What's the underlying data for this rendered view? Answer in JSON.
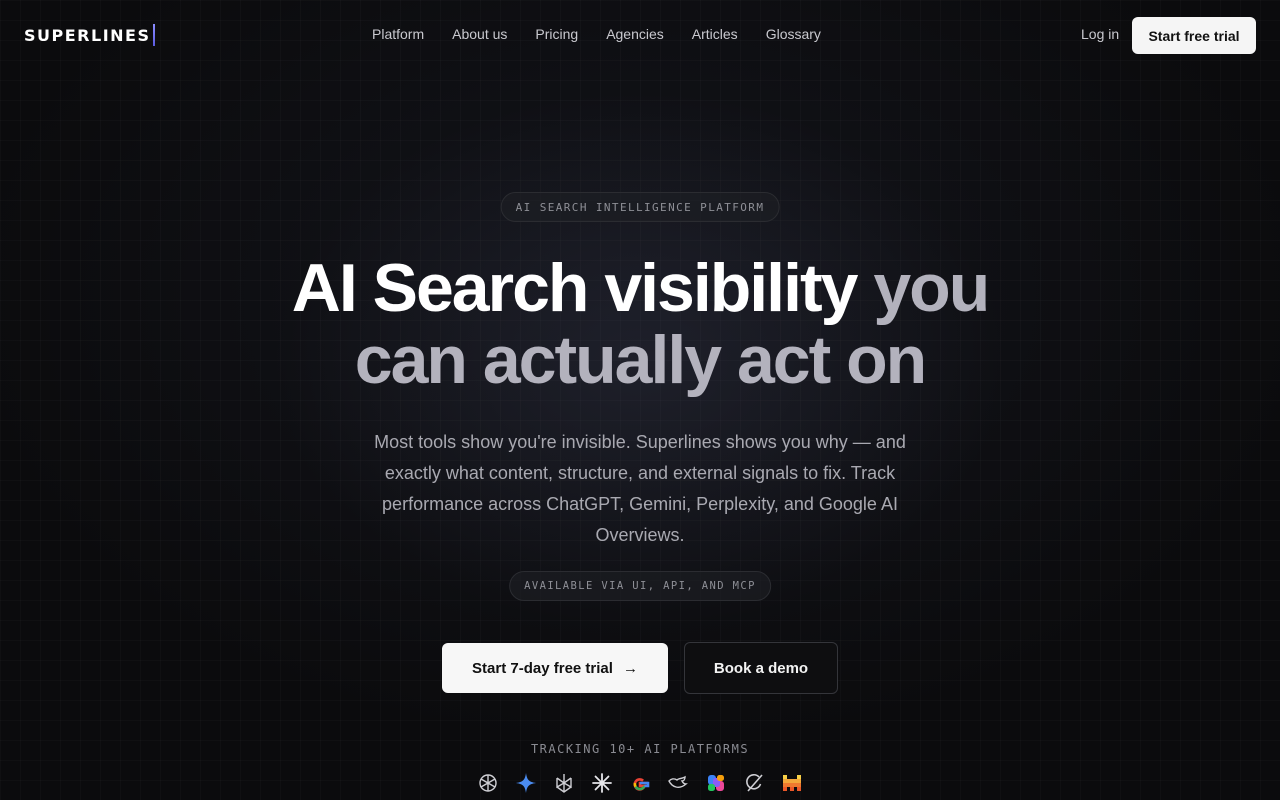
{
  "brand": {
    "name": "SUPERLINES"
  },
  "nav": {
    "items": [
      "Platform",
      "About us",
      "Pricing",
      "Agencies",
      "Articles",
      "Glossary"
    ],
    "login": "Log in",
    "trial": "Start free trial"
  },
  "hero": {
    "eyebrow": "AI SEARCH INTELLIGENCE PLATFORM",
    "title_white": "AI Search visibility",
    "title_gray_1": "you",
    "title_gray_2": "can actually act on",
    "subtitle": "Most tools show you're invisible. Superlines shows you why — and exactly what content, structure, and external signals to fix. Track performance across ChatGPT, Gemini, Perplexity, and Google AI Overviews.",
    "availability": "AVAILABLE VIA UI, API, AND MCP",
    "cta_primary": "Start 7-day free trial",
    "cta_primary_arrow": "→",
    "cta_secondary": "Book a demo"
  },
  "platforms": {
    "label": "TRACKING 10+ AI PLATFORMS",
    "icons": [
      "openai-icon",
      "gemini-icon",
      "perplexity-icon",
      "claude-icon",
      "google-icon",
      "deepseek-icon",
      "copilot-icon",
      "grok-icon",
      "mistral-icon"
    ]
  }
}
